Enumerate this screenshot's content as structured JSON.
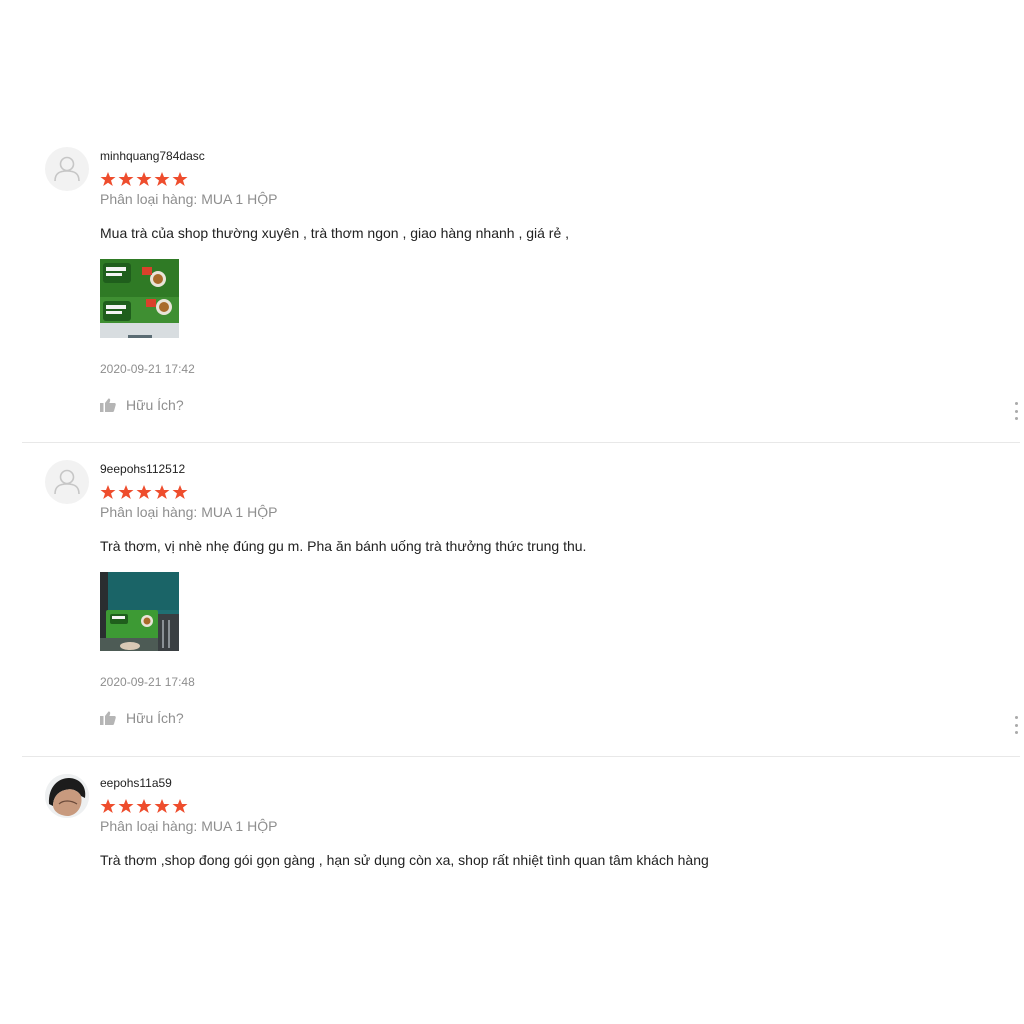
{
  "reviews": [
    {
      "username": "minhquang784dasc",
      "rating": 5,
      "variation": "Phân loại hàng: MUA 1 HỘP",
      "comment": "Mua trà của shop thường xuyên , trà thơm ngon , giao hàng nhanh , giá rẻ ,",
      "time": "2020-09-21 17:42",
      "helpful_label": "Hữu Ích?"
    },
    {
      "username": "9eepohs112512",
      "rating": 5,
      "variation": "Phân loại hàng: MUA 1 HỘP",
      "comment": "Trà thơm, vị nhè nhẹ đúng gu m. Pha ăn bánh uống trà thưởng thức trung thu.",
      "time": "2020-09-21 17:48",
      "helpful_label": "Hữu Ích?"
    },
    {
      "username": "eepohs11a59",
      "rating": 5,
      "variation": "Phân loại hàng: MUA 1 HỘP",
      "comment": "Trà thơm ,shop đong gói gọn gàng , hạn sử dụng còn xa, shop rất nhiệt tình quan tâm khách hàng"
    }
  ],
  "colors": {
    "star": "#ee4d2d",
    "muted": "#8e8e8e",
    "text": "#222222",
    "divider": "#e8e8e8"
  },
  "icons": {
    "avatar_placeholder": "user-silhouette-icon",
    "star": "star-icon",
    "like": "thumbs-up-icon",
    "more": "vertical-dots-icon"
  }
}
